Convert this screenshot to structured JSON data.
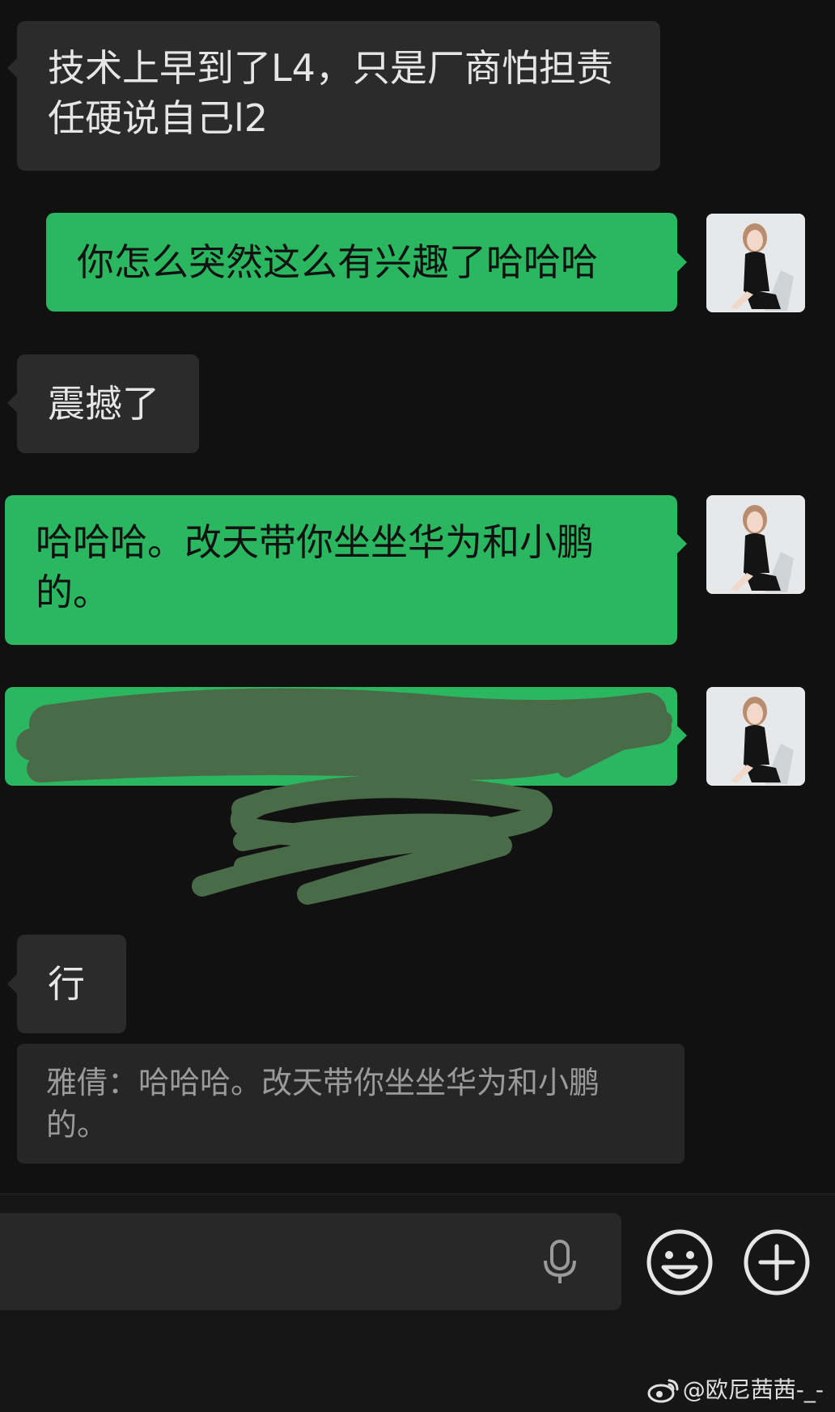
{
  "messages": [
    {
      "side": "in",
      "text": "技术上早到了L4，只是厂商怕担责任硬说自己l2"
    },
    {
      "side": "out",
      "text": "你怎么突然这么有兴趣了哈哈哈"
    },
    {
      "side": "in",
      "text": "震撼了"
    },
    {
      "side": "out",
      "text": "哈哈哈。改天带你坐坐华为和小鹏的。"
    },
    {
      "side": "out",
      "text": "",
      "redacted": true
    },
    {
      "side": "in",
      "text": "行"
    }
  ],
  "quote": {
    "text": "雅倩：哈哈哈。改天带你坐坐华为和小鹏的。"
  },
  "input": {
    "placeholder": ""
  },
  "icons": {
    "voice": "microphone-icon",
    "emoji": "smiley-icon",
    "more": "plus-circle-icon",
    "watermark": "weibo-logo-icon"
  },
  "watermark": {
    "text": "@欧尼茜茜-_-"
  },
  "colors": {
    "background": "#111111",
    "incoming_bubble": "#2b2b2b",
    "outgoing_bubble": "#2bb660",
    "scribble": "#4a6b48"
  }
}
